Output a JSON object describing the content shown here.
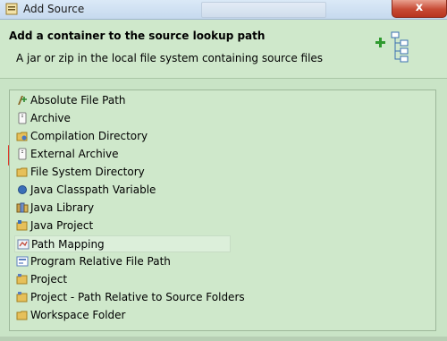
{
  "window": {
    "title": "Add Source",
    "close_label": "x"
  },
  "header": {
    "heading": "Add a container to the source lookup path",
    "description": "A jar or zip in the local file system containing source files"
  },
  "list": {
    "selected_index": 3,
    "items": [
      {
        "label": "Absolute File Path",
        "icon": "absolute-path-icon"
      },
      {
        "label": "Archive",
        "icon": "archive-icon"
      },
      {
        "label": "Compilation Directory",
        "icon": "folder-icon"
      },
      {
        "label": "External Archive",
        "icon": "archive-icon"
      },
      {
        "label": "File System Directory",
        "icon": "folder-icon"
      },
      {
        "label": "Java Classpath Variable",
        "icon": "variable-icon"
      },
      {
        "label": "Java Library",
        "icon": "library-icon"
      },
      {
        "label": "Java Project",
        "icon": "java-project-icon"
      },
      {
        "label": "Path Mapping",
        "icon": "path-mapping-icon"
      },
      {
        "label": "Program Relative File Path",
        "icon": "relative-path-icon"
      },
      {
        "label": "Project",
        "icon": "project-folder-icon"
      },
      {
        "label": "Project - Path Relative to Source Folders",
        "icon": "project-folder-icon"
      },
      {
        "label": "Workspace Folder",
        "icon": "folder-icon"
      }
    ]
  }
}
